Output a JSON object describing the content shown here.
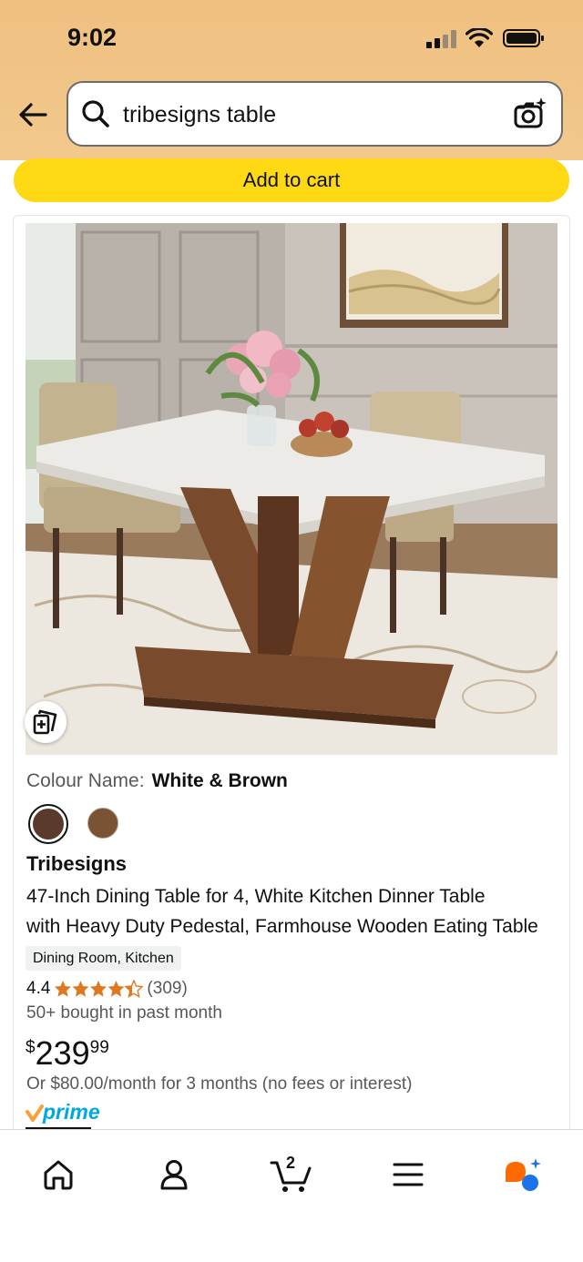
{
  "status_bar": {
    "time": "9:02"
  },
  "search": {
    "query": "tribesigns table"
  },
  "add_to_cart_label": "Add to cart",
  "product": {
    "colour_label": "Colour Name:",
    "colour_value": "White & Brown",
    "brand": "Tribesigns",
    "title_line1": "47-Inch Dining Table for 4, White Kitchen Dinner Table",
    "title_line2": "with Heavy Duty Pedestal, Farmhouse Wooden Eating Table",
    "tag": "Dining Room, Kitchen",
    "rating": "4.4",
    "rating_value": 4.4,
    "rating_count": "(309)",
    "bought": "50+ bought in past month",
    "price_symbol": "$",
    "price_whole": "239",
    "price_fraction": "99",
    "instalment": "Or $80.00/month for 3 months (no fees or interest)",
    "prime_label": "prime"
  },
  "nav": {
    "cart_count": "2"
  },
  "colors": {
    "header_bg": "#f2c88d",
    "add_to_cart_bg": "#ffd814",
    "star": "#de7921",
    "prime_blue": "#00a8e1",
    "prime_check": "#f7a03e",
    "rufus_orange": "#ff6a00",
    "rufus_blue": "#1a73e8"
  },
  "icons": [
    "back-arrow-icon",
    "search-icon",
    "camera-icon",
    "view-in-room-icon",
    "home-icon",
    "account-icon",
    "cart-icon",
    "menu-icon",
    "rufus-icon"
  ]
}
